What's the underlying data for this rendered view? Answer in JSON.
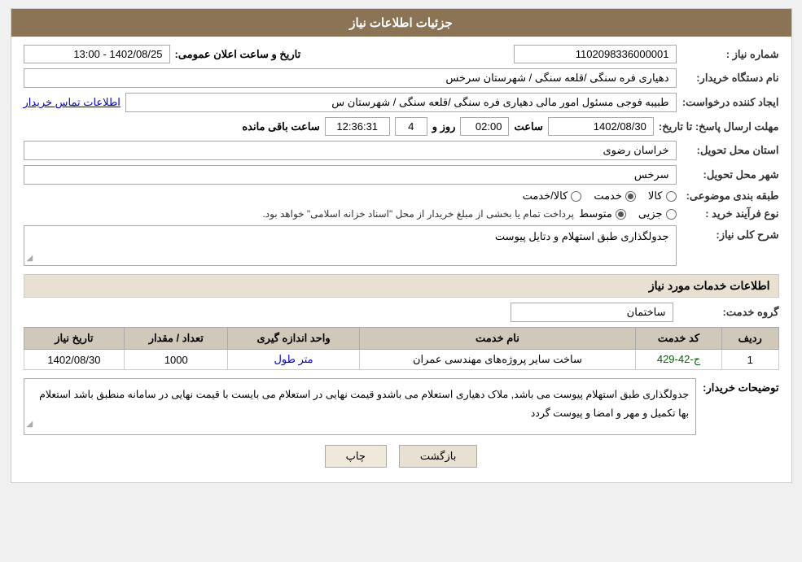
{
  "header": {
    "title": "جزئیات اطلاعات نیاز"
  },
  "fields": {
    "need_number_label": "شماره نیاز :",
    "need_number_value": "1102098336000001",
    "buyer_org_label": "نام دستگاه خریدار:",
    "buyer_org_value": "دهیاری فره سنگی /قلعه سنگی / شهرستان سرخس",
    "creator_label": "ایجاد کننده درخواست:",
    "creator_value": "طبیبه فوجی مسئول امور مالی دهیاری فره سنگی /قلعه سنگی / شهرستان س",
    "contact_link": "اطلاعات تماس خریدار",
    "deadline_label": "مهلت ارسال پاسخ: تا تاریخ:",
    "deadline_date": "1402/08/30",
    "deadline_time_label": "ساعت",
    "deadline_time": "02:00",
    "deadline_days_label": "روز و",
    "deadline_days": "4",
    "deadline_remaining_label": "ساعت باقی مانده",
    "deadline_remaining": "12:36:31",
    "province_label": "استان محل تحویل:",
    "province_value": "خراسان رضوی",
    "city_label": "شهر محل تحویل:",
    "city_value": "سرخس",
    "category_label": "طبقه بندی موضوعی:",
    "category_kala": "کالا",
    "category_khadamat": "خدمت",
    "category_kala_khadamat": "کالا/خدمت",
    "category_selected": "خدمت",
    "purchase_type_label": "نوع فرآیند خرید :",
    "purchase_type_jozei": "جزیی",
    "purchase_type_motawaset": "متوسط",
    "purchase_type_selected": "متوسط",
    "purchase_type_text": "پرداخت تمام یا بخشی از مبلغ خریدار از محل \"اسناد خزانه اسلامی\" خواهد بود.",
    "announcement_label": "تاریخ و ساعت اعلان عمومی:",
    "announcement_value": "1402/08/25 - 13:00",
    "description_label": "شرح کلی نیاز:",
    "description_value": "جدولگذاری طبق استهلام و دتایل پیوست",
    "service_section_title": "اطلاعات خدمات مورد نیاز",
    "service_group_label": "گروه خدمت:",
    "service_group_value": "ساختمان",
    "table": {
      "headers": [
        "ردیف",
        "کد خدمت",
        "نام خدمت",
        "واحد اندازه گیری",
        "تعداد / مقدار",
        "تاریخ نیاز"
      ],
      "rows": [
        {
          "row": "1",
          "code": "ج-42-429",
          "name": "ساخت سایر پروژه‌های مهندسی عمران",
          "unit": "متر طول",
          "quantity": "1000",
          "date": "1402/08/30"
        }
      ]
    },
    "buyer_notes_label": "توضیحات خریدار:",
    "buyer_notes_value": "جدولگذاری طبق استهلام  پیوست می باشد, ملاک  دهیاری استعلام  می باشدو قیمت نهایی در استعلام می بایست با قیمت  نهایی در سامانه  منطبق باشد استعلام  بها  تکمیل  و مهر و امضا و پیوست  گردد",
    "btn_back": "بازگشت",
    "btn_print": "چاپ"
  }
}
